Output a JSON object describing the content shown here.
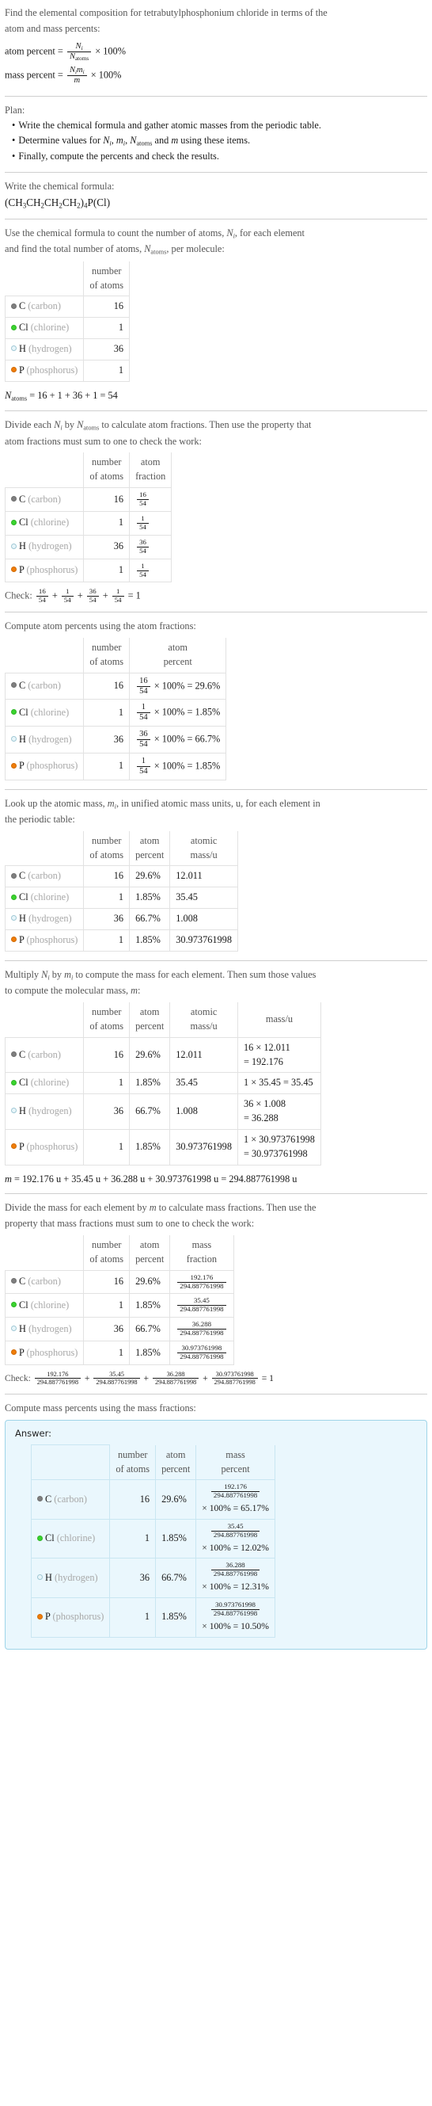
{
  "question": {
    "line1": "Find the elemental composition for tetrabutylphosphonium chloride in terms of the",
    "line2": "atom and mass percents:",
    "atom_percent_label": "atom percent =",
    "atom_percent_num": "N",
    "atom_percent_num_sub": "i",
    "atom_percent_den": "N",
    "atom_percent_den_sub": "atoms",
    "atom_percent_tail": "× 100%",
    "mass_percent_label": "mass percent =",
    "mass_percent_num": "N",
    "mass_percent_num_sub": "i",
    "mass_percent_num2": "m",
    "mass_percent_num2_sub": "i",
    "mass_percent_den": "m",
    "mass_percent_tail": "× 100%"
  },
  "plan": {
    "title": "Plan:",
    "items": [
      "Write the chemical formula and gather atomic masses from the periodic table.",
      "Determine values for Nᵢ, mᵢ, N_atoms and m using these items.",
      "Finally, compute the percents and check the results."
    ],
    "item2_parts": {
      "pre": "Determine values for ",
      "n_i": "N",
      "n_i_sub": "i",
      "m_i": "m",
      "m_i_sub": "i",
      "n_atoms": "N",
      "n_atoms_sub": "atoms",
      "mid": " and ",
      "m": "m",
      "post": " using these items."
    }
  },
  "formula_section": {
    "prompt": "Write the chemical formula:",
    "formula_plain": "(CH3CH2CH2CH2)4P(Cl)",
    "formula_parts": [
      {
        "t": "(CH",
        "sub": "3"
      },
      {
        "t": "CH",
        "sub": "2"
      },
      {
        "t": "CH",
        "sub": "2"
      },
      {
        "t": "CH",
        "sub": "2"
      },
      {
        "t": ")",
        "sub": "4"
      },
      {
        "t": "P(Cl)",
        "sub": ""
      }
    ]
  },
  "elements": [
    {
      "symbol": "C",
      "name": "(carbon)",
      "color": "#7f7f7f",
      "border": "#6f6f6f",
      "count": "16",
      "fraction_num": "16",
      "fraction_den": "54",
      "atom_percent": "29.6%",
      "atomic_mass": "12.011",
      "mass_expr_l": "16 × 12.011",
      "mass_expr_r": "= 192.176",
      "mass_one_line": false,
      "mass_value": "192.176",
      "mass_percent": "65.17%"
    },
    {
      "symbol": "Cl",
      "name": "(chlorine)",
      "color": "#3ad42e",
      "border": "#2fb526",
      "count": "1",
      "fraction_num": "1",
      "fraction_den": "54",
      "atom_percent": "1.85%",
      "atomic_mass": "35.45",
      "mass_expr_l": "1 × 35.45 = 35.45",
      "mass_expr_r": "",
      "mass_one_line": true,
      "mass_value": "35.45",
      "mass_percent": "12.02%"
    },
    {
      "symbol": "H",
      "name": "(hydrogen)",
      "color": "#e8f6fa",
      "border": "#9fc7d4",
      "count": "36",
      "fraction_num": "36",
      "fraction_den": "54",
      "atom_percent": "66.7%",
      "atomic_mass": "1.008",
      "mass_expr_l": "36 × 1.008",
      "mass_expr_r": "= 36.288",
      "mass_one_line": false,
      "mass_value": "36.288",
      "mass_percent": "12.31%"
    },
    {
      "symbol": "P",
      "name": "(phosphorus)",
      "color": "#f07d07",
      "border": "#d06a04",
      "count": "1",
      "fraction_num": "1",
      "fraction_den": "54",
      "atom_percent": "1.85%",
      "atomic_mass": "30.973761998",
      "mass_expr_l": "1 × 30.973761998",
      "mass_expr_r": "= 30.973761998",
      "mass_one_line": false,
      "mass_value": "30.973761998",
      "mass_percent": "10.50%"
    }
  ],
  "headers": {
    "number_of_atoms_l1": "number",
    "number_of_atoms_l2": "of atoms",
    "atom_fraction_l1": "atom",
    "atom_fraction_l2": "fraction",
    "atom_percent_l1": "atom",
    "atom_percent_l2": "percent",
    "atomic_mass_l1": "atomic",
    "atomic_mass_l2": "mass/u",
    "mass_u": "mass/u",
    "mass_fraction_l1": "mass",
    "mass_fraction_l2": "fraction",
    "mass_percent_l1": "mass",
    "mass_percent_l2": "percent"
  },
  "count_section": {
    "line1_pre": "Use the chemical formula to count the number of atoms, ",
    "line1_ni": "N",
    "line1_ni_sub": "i",
    "line1_post": ", for each element",
    "line2_pre": "and find the total number of atoms, ",
    "line2_natoms": "N",
    "line2_natoms_sub": "atoms",
    "line2_post": ", per molecule:",
    "total_lhs": "N",
    "total_lhs_sub": "atoms",
    "total_expr": "= 16 + 1 + 36 + 1 = 54"
  },
  "fraction_section": {
    "line1_pre": "Divide each ",
    "ni": "N",
    "ni_sub": "i",
    "line1_mid": " by ",
    "natoms": "N",
    "natoms_sub": "atoms",
    "line1_post": " to calculate atom fractions. Then use the property that",
    "line2": "atom fractions must sum to one to check the work:",
    "check_label": "Check:",
    "check_terms": [
      {
        "num": "16",
        "den": "54"
      },
      {
        "num": "1",
        "den": "54"
      },
      {
        "num": "36",
        "den": "54"
      },
      {
        "num": "1",
        "den": "54"
      }
    ],
    "check_result": "= 1",
    "plus": "+"
  },
  "atom_percent_section": {
    "prompt": "Compute atom percents using the atom fractions:",
    "times_100": "× 100% ="
  },
  "atomic_mass_section": {
    "line1_pre": "Look up the atomic mass, ",
    "mi": "m",
    "mi_sub": "i",
    "line1_post": ", in unified atomic mass units, u, for each element in",
    "line2": "the periodic table:"
  },
  "mass_section": {
    "line1_pre": "Multiply ",
    "ni": "N",
    "ni_sub": "i",
    "line1_mid": " by ",
    "mi": "m",
    "mi_sub": "i",
    "line1_post": " to compute the mass for each element. Then sum those values",
    "line2_pre": "to compute the molecular mass, ",
    "m": "m",
    "line2_post": ":",
    "total_line": "m = 192.176 u + 35.45 u + 36.288 u + 30.973761998 u = 294.887761998 u",
    "total_m_italic": "m",
    "total_rest": "= 192.176 u + 35.45 u + 36.288 u + 30.973761998 u = 294.887761998 u"
  },
  "mass_fraction_section": {
    "line1_pre": "Divide the mass for each element by ",
    "m": "m",
    "line1_post": " to calculate mass fractions. Then use the",
    "line2": "property that mass fractions must sum to one to check the work:",
    "denominator": "294.887761998",
    "check_label": "Check:",
    "check_result": "= 1",
    "plus": "+"
  },
  "mass_percent_section": {
    "prompt": "Compute mass percents using the mass fractions:",
    "answer_label": "Answer:",
    "denominator": "294.887761998",
    "times_100": "× 100% ="
  },
  "colors": {
    "answer_bg": "#eaf7fd",
    "answer_border": "#9fd4e8",
    "rule": "#cfcfcf",
    "table_border": "#e2e2e2",
    "muted_text": "#555555",
    "element_name": "#a8a8a8"
  }
}
